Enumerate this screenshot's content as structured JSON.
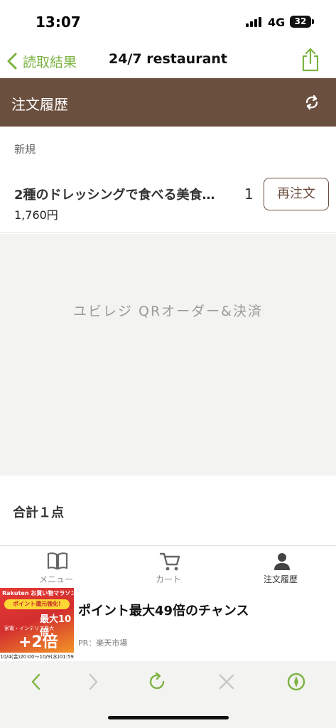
{
  "status_bar": {
    "time": "13:07",
    "network": "4G",
    "battery": "32"
  },
  "nav": {
    "back_label": "読取結果",
    "title": "24/7 restaurant"
  },
  "history": {
    "title": "注文履歴"
  },
  "section": {
    "label": "新規"
  },
  "order_items": [
    {
      "name": "2種のドレッシングで食べる美食…",
      "price": "1,760円",
      "qty": "1",
      "reorder_label": "再注文"
    }
  ],
  "brand": {
    "logo_text": "ユビレジ QRオーダー&決済"
  },
  "total": {
    "label": "合計１点"
  },
  "tabs": [
    {
      "label": "メニュー",
      "icon": "book-icon"
    },
    {
      "label": "カート",
      "icon": "cart-icon"
    },
    {
      "label": "注文履歴",
      "icon": "person-icon"
    }
  ],
  "ad": {
    "title": "ポイント最大49倍のチャンス",
    "source": "PR：楽天市場",
    "image_text": {
      "top": "Rakuten お買い物マラソン",
      "mid": "ポイント還元強化!",
      "ten": "最大10倍",
      "category": "家電・インテリア最大",
      "plus": "+2倍",
      "date": "10/4(金)20:00〜10/9(水)01:59"
    }
  },
  "colors": {
    "accent_green": "#7cb342",
    "header_brown": "#6b4f3f"
  }
}
